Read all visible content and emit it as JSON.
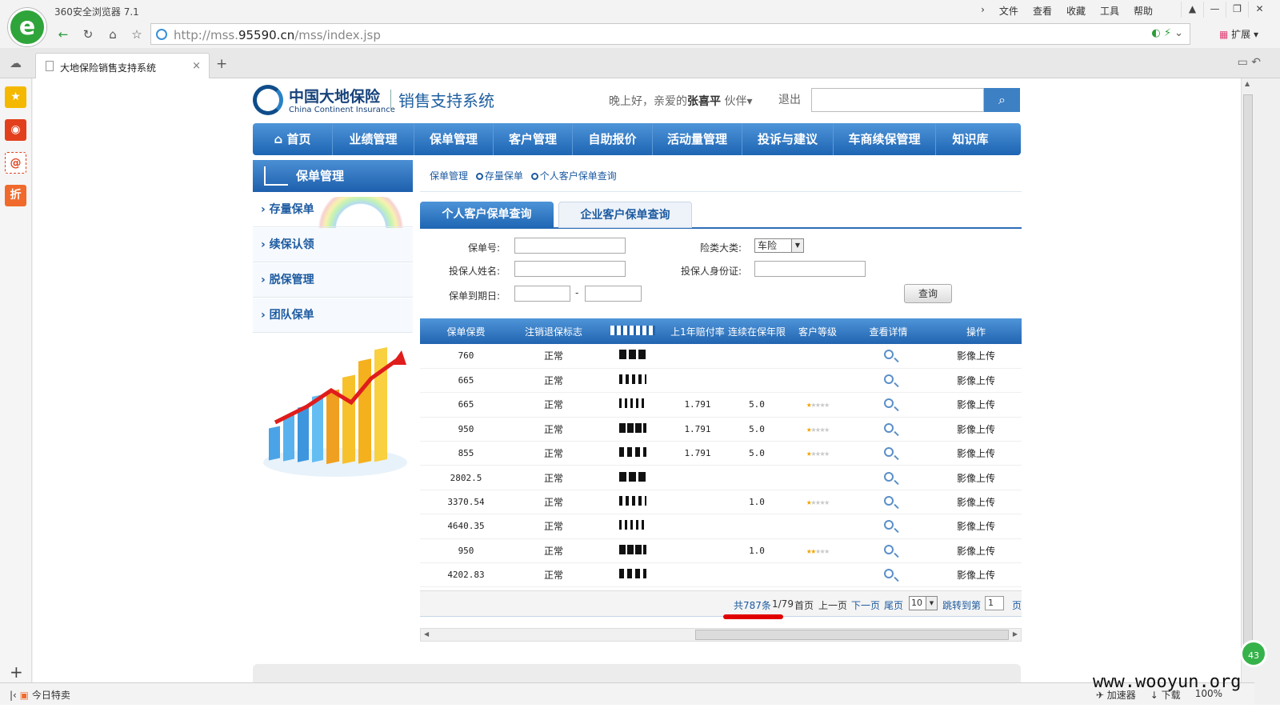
{
  "browser": {
    "title": "360安全浏览器 7.1",
    "menu": [
      "文件",
      "查看",
      "收藏",
      "工具",
      "帮助"
    ],
    "url_prefix": "http://mss.",
    "url_domain": "95590.cn",
    "url_path": "/mss/index.jsp",
    "extend_label": "扩展",
    "tab_title": "大地保险销售支持系统",
    "status_left": "今日特卖",
    "status_items": [
      "加速器",
      "下载",
      "100%"
    ],
    "badge": "43",
    "watermark": "www.wooyun.org"
  },
  "header": {
    "brand_cn": "中国大地保险",
    "brand_en": "China Continent Insurance",
    "system_name": "销售支持系统",
    "greeting": "晚上好，亲爱的",
    "user_name": "张喜平",
    "role": "伙伴",
    "logout": "退出"
  },
  "nav": [
    "首页",
    "业绩管理",
    "保单管理",
    "客户管理",
    "自助报价",
    "活动量管理",
    "投诉与建议",
    "车商续保管理",
    "知识库"
  ],
  "left_panel": {
    "title": "保单管理",
    "items": [
      "存量保单",
      "续保认领",
      "脱保管理",
      "团队保单"
    ]
  },
  "breadcrumb": [
    "保单管理",
    "存量保单",
    "个人客户保单查询"
  ],
  "subtabs": {
    "active": "个人客户保单查询",
    "inactive": "企业客户保单查询"
  },
  "form": {
    "policy_no_label": "保单号:",
    "insurance_type_label": "险类大类:",
    "insurance_type_value": "车险",
    "holder_name_label": "投保人姓名:",
    "holder_id_label": "投保人身份证:",
    "expiry_label": "保单到期日:",
    "range_sep": "-",
    "query_button": "查询"
  },
  "table": {
    "headers": [
      "保单保费",
      "注销退保标志",
      "",
      "上1年赔付率",
      "连续在保年限",
      "客户等级",
      "查看详情",
      "操作"
    ],
    "rows": [
      {
        "premium": "760",
        "status": "正常",
        "rate": "",
        "years": "",
        "stars": 0,
        "action": "影像上传"
      },
      {
        "premium": "665",
        "status": "正常",
        "rate": "",
        "years": "",
        "stars": 0,
        "action": "影像上传"
      },
      {
        "premium": "665",
        "status": "正常",
        "rate": "1.791",
        "years": "5.0",
        "stars": 1,
        "action": "影像上传"
      },
      {
        "premium": "950",
        "status": "正常",
        "rate": "1.791",
        "years": "5.0",
        "stars": 1,
        "action": "影像上传"
      },
      {
        "premium": "855",
        "status": "正常",
        "rate": "1.791",
        "years": "5.0",
        "stars": 1,
        "action": "影像上传"
      },
      {
        "premium": "2802.5",
        "status": "正常",
        "rate": "",
        "years": "",
        "stars": 0,
        "action": "影像上传"
      },
      {
        "premium": "3370.54",
        "status": "正常",
        "rate": "",
        "years": "1.0",
        "stars": 1,
        "action": "影像上传"
      },
      {
        "premium": "4640.35",
        "status": "正常",
        "rate": "",
        "years": "",
        "stars": 0,
        "action": "影像上传"
      },
      {
        "premium": "950",
        "status": "正常",
        "rate": "",
        "years": "1.0",
        "stars": 2,
        "action": "影像上传"
      },
      {
        "premium": "4202.83",
        "status": "正常",
        "rate": "",
        "years": "",
        "stars": 0,
        "action": "影像上传"
      }
    ]
  },
  "pager": {
    "total": "共787条",
    "page": "1/79",
    "first": "首页",
    "prev": "上一页",
    "next": "下一页",
    "last": "尾页",
    "page_size": "10",
    "jump_label": "跳转到第",
    "jump_value": "1",
    "page_unit": "页"
  },
  "colors": {
    "brand_blue": "#1d64b3",
    "link_blue": "#1c5aa0",
    "star": "#f0a500",
    "highlight_red": "#e00000"
  }
}
